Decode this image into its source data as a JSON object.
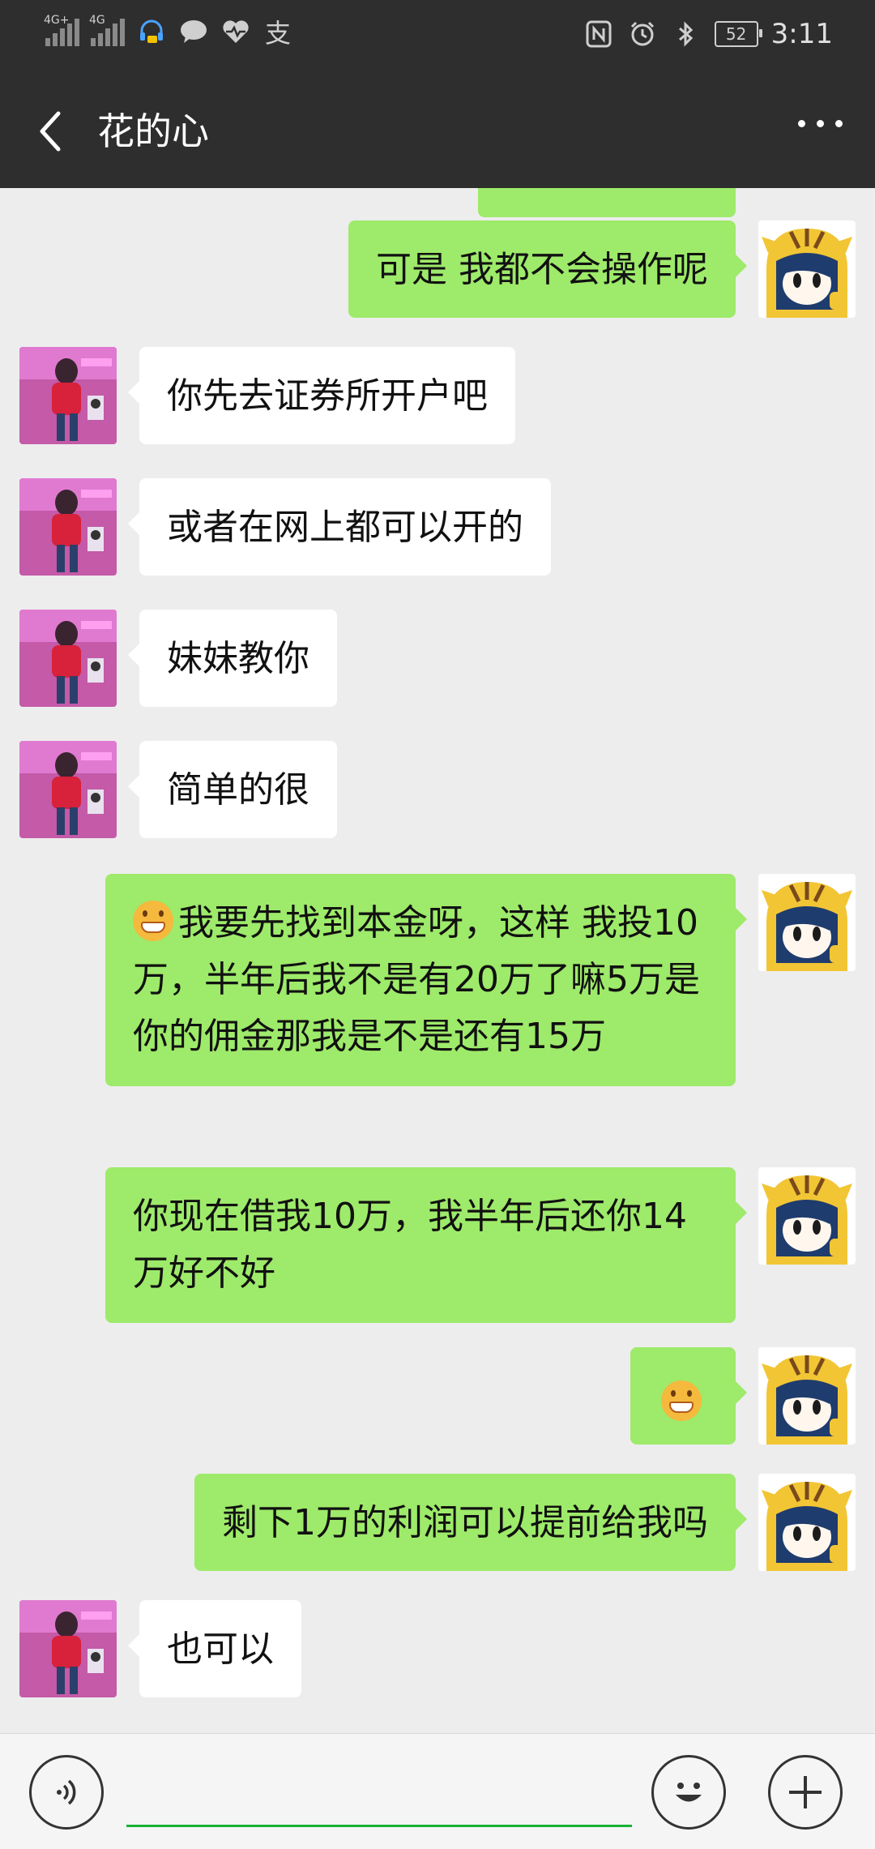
{
  "status_bar": {
    "network_1": "4G+",
    "network_2": "4G",
    "battery": "52",
    "time": "3:11"
  },
  "header": {
    "title": "花的心"
  },
  "messages": [
    {
      "side": "right",
      "text": "可是  我都不会操作呢"
    },
    {
      "side": "left",
      "text": "你先去证券所开户吧"
    },
    {
      "side": "left",
      "text": "或者在网上都可以开的"
    },
    {
      "side": "left",
      "text": "妹妹教你"
    },
    {
      "side": "left",
      "text": "简单的很"
    },
    {
      "side": "right",
      "emoji": "grin-emoji",
      "text": "我要先找到本金呀，这样  我投10万，半年后我不是有20万了嘛5万是你的佣金那我是不是还有15万"
    },
    {
      "side": "right",
      "text": "你现在借我10万，我半年后还你14万好不好"
    },
    {
      "side": "right",
      "emoji": "grin-emoji",
      "text": ""
    },
    {
      "side": "right",
      "text": "剩下1万的利润可以提前给我吗"
    },
    {
      "side": "left",
      "text": "也可以"
    }
  ],
  "colors": {
    "sent_bubble": "#9eea6a",
    "received_bubble": "#ffffff",
    "chat_background": "#ededed",
    "header_background": "#2e2e2e",
    "input_underline": "#19b236"
  },
  "icons": {
    "back": "back-arrow-icon",
    "more": "more-icon",
    "voice": "voice-icon",
    "emoji": "emoji-icon",
    "plus": "plus-icon"
  }
}
